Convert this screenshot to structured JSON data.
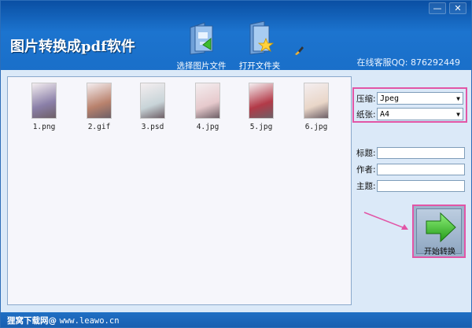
{
  "window": {
    "minimize_label": "—",
    "close_label": "✕"
  },
  "header": {
    "title": "图片转换成pdf软件",
    "tools": [
      {
        "label": "选择图片文件",
        "icon": "select-image-folder-icon"
      },
      {
        "label": "打开文件夹",
        "icon": "open-folder-icon"
      }
    ],
    "qq_label": "在线客服QQ: 876292449"
  },
  "gallery": {
    "items": [
      {
        "name": "1.png",
        "color": "#8a7fa8"
      },
      {
        "name": "2.gif",
        "color": "#b9826d"
      },
      {
        "name": "3.psd",
        "color": "#c8d4d8"
      },
      {
        "name": "4.jpg",
        "color": "#e6c9cc"
      },
      {
        "name": "5.jpg",
        "color": "#b33a48"
      },
      {
        "name": "6.jpg",
        "color": "#e9d6c8"
      }
    ]
  },
  "settings": {
    "compress_label": "压缩:",
    "compress_value": "Jpeg",
    "paper_label": "纸张:",
    "paper_value": "A4",
    "title_label": "标题:",
    "author_label": "作者:",
    "subject_label": "主题:"
  },
  "convert": {
    "label": "开始转换"
  },
  "status": {
    "brand": "狸窝下载网@",
    "site": "www.leawo.cn"
  },
  "colors": {
    "header": "#1c74cf",
    "highlight": "#e255a6",
    "go_green": "#3dbb2f"
  }
}
